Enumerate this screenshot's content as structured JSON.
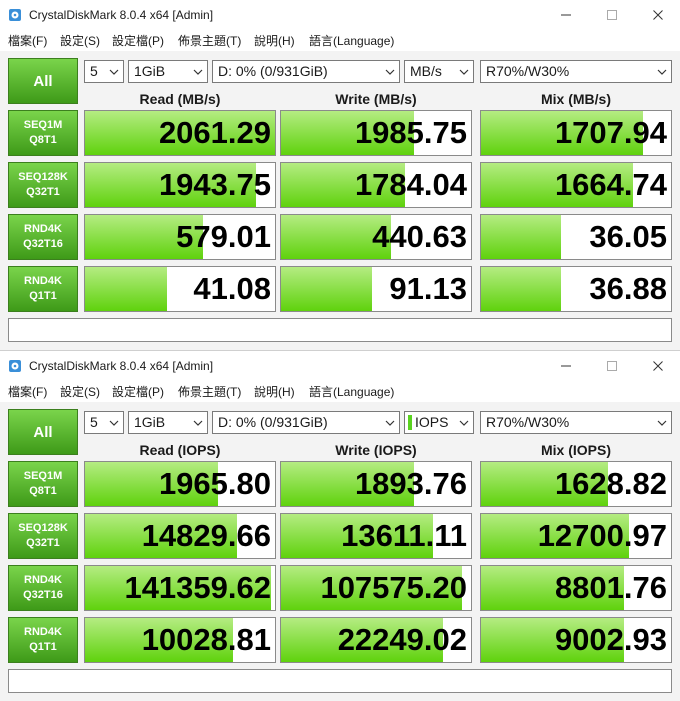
{
  "windows": [
    {
      "title": "CrystalDiskMark 8.0.4 x64 [Admin]",
      "menu": [
        "檔案(F)",
        "設定(S)",
        "設定檔(P)",
        "佈景主題(T)",
        "說明(H)",
        "語言(Language)"
      ],
      "all_label": "All",
      "count": "5",
      "size": "1GiB",
      "drive": "D: 0% (0/931GiB)",
      "unit": "MB/s",
      "unit_marker": false,
      "mix": "R70%/W30%",
      "headers": [
        "Read (MB/s)",
        "Write (MB/s)",
        "Mix (MB/s)"
      ],
      "rows": [
        {
          "line1": "SEQ1M",
          "line2": "Q8T1",
          "read": "2061.29",
          "write": "1985.75",
          "mix": "1707.94",
          "fill": [
            1.0,
            0.7,
            0.85
          ]
        },
        {
          "line1": "SEQ128K",
          "line2": "Q32T1",
          "read": "1943.75",
          "write": "1784.04",
          "mix": "1664.74",
          "fill": [
            0.9,
            0.65,
            0.8
          ]
        },
        {
          "line1": "RND4K",
          "line2": "Q32T16",
          "read": "579.01",
          "write": "440.63",
          "mix": "36.05",
          "fill": [
            0.62,
            0.58,
            0.42
          ]
        },
        {
          "line1": "RND4K",
          "line2": "Q1T1",
          "read": "41.08",
          "write": "91.13",
          "mix": "36.88",
          "fill": [
            0.43,
            0.48,
            0.42
          ]
        }
      ],
      "comment": ""
    },
    {
      "title": "CrystalDiskMark 8.0.4 x64 [Admin]",
      "menu": [
        "檔案(F)",
        "設定(S)",
        "設定檔(P)",
        "佈景主題(T)",
        "說明(H)",
        "語言(Language)"
      ],
      "all_label": "All",
      "count": "5",
      "size": "1GiB",
      "drive": "D: 0% (0/931GiB)",
      "unit": "IOPS",
      "unit_marker": true,
      "mix": "R70%/W30%",
      "headers": [
        "Read (IOPS)",
        "Write (IOPS)",
        "Mix (IOPS)"
      ],
      "rows": [
        {
          "line1": "SEQ1M",
          "line2": "Q8T1",
          "read": "1965.80",
          "write": "1893.76",
          "mix": "1628.82",
          "fill": [
            0.7,
            0.7,
            0.67
          ]
        },
        {
          "line1": "SEQ128K",
          "line2": "Q32T1",
          "read": "14829.66",
          "write": "13611.11",
          "mix": "12700.97",
          "fill": [
            0.8,
            0.8,
            0.78
          ]
        },
        {
          "line1": "RND4K",
          "line2": "Q32T16",
          "read": "141359.62",
          "write": "107575.20",
          "mix": "8801.76",
          "fill": [
            0.98,
            0.95,
            0.75
          ]
        },
        {
          "line1": "RND4K",
          "line2": "Q1T1",
          "read": "10028.81",
          "write": "22249.02",
          "mix": "9002.93",
          "fill": [
            0.78,
            0.85,
            0.75
          ]
        }
      ],
      "comment": ""
    }
  ],
  "icons": {
    "app": "crystaldiskmark-icon",
    "minimize": "minimize-icon",
    "maximize": "maximize-icon",
    "close": "close-icon",
    "dropdown": "chevron-down-icon"
  },
  "colors": {
    "accent_green": "#3e9a18",
    "bar_green": "#5fd20d",
    "unit_marker": "#5ad31f"
  }
}
